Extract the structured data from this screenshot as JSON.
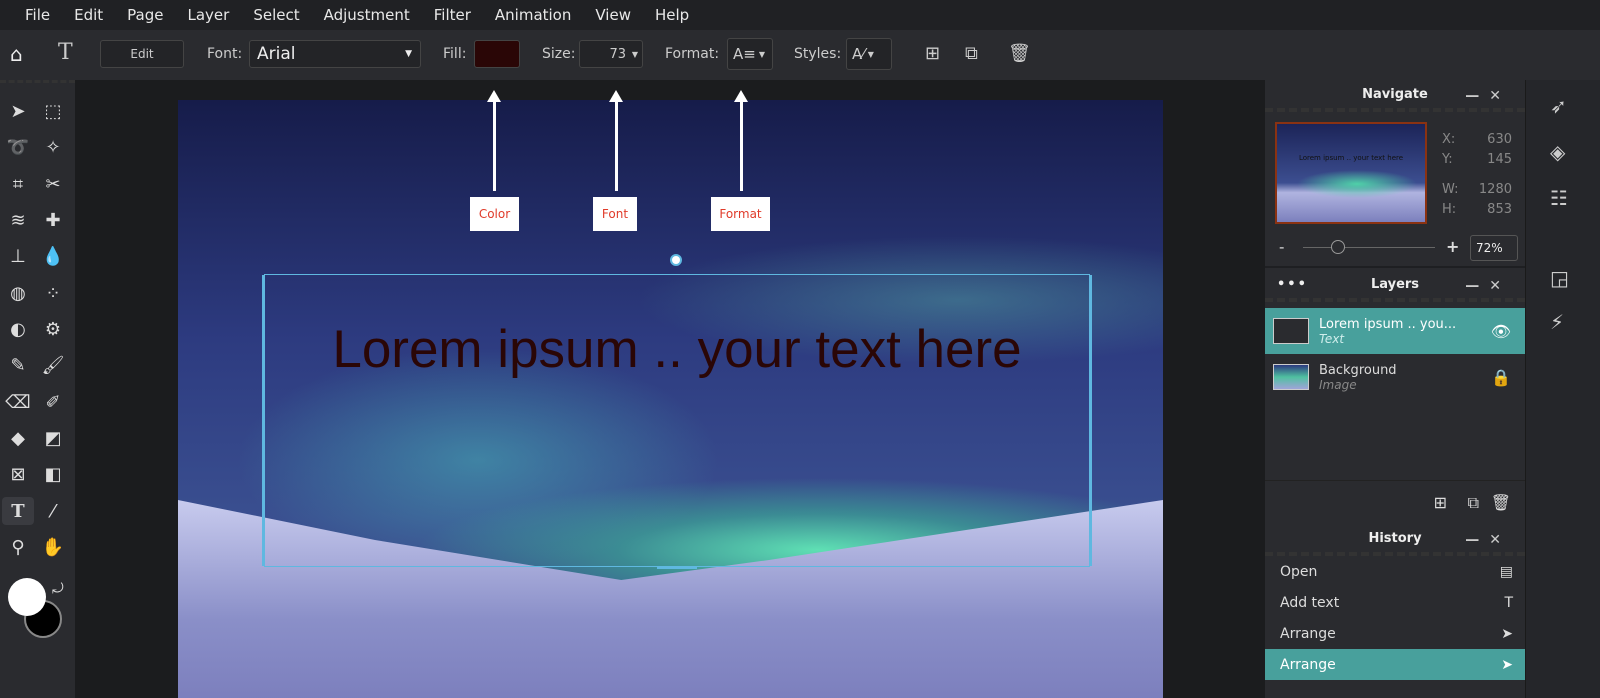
{
  "menu": [
    "File",
    "Edit",
    "Page",
    "Layer",
    "Select",
    "Adjustment",
    "Filter",
    "Animation",
    "View",
    "Help"
  ],
  "toolbar": {
    "edit": "Edit",
    "font_label": "Font:",
    "font_value": "Arial",
    "fill_label": "Fill:",
    "fill_color": "#2a0606",
    "size_label": "Size:",
    "size_value": "73",
    "format_label": "Format:",
    "styles_label": "Styles:"
  },
  "canvas": {
    "text": "Lorem ipsum .. your text here",
    "annotations": [
      "Color",
      "Font",
      "Format"
    ]
  },
  "navigate": {
    "title": "Navigate",
    "x_label": "X:",
    "x": "630",
    "y_label": "Y:",
    "y": "145",
    "w_label": "W:",
    "w": "1280",
    "h_label": "H:",
    "h": "853",
    "zoom": "72%",
    "minus": "-",
    "plus": "+",
    "thumb_text": "Lorem ipsum .. your text here"
  },
  "layers": {
    "title": "Layers",
    "items": [
      {
        "name": "Lorem ipsum .. you...",
        "type": "Text"
      },
      {
        "name": "Background",
        "type": "Image"
      }
    ]
  },
  "history": {
    "title": "History",
    "items": [
      "Open",
      "Add text",
      "Arrange",
      "Arrange"
    ]
  }
}
